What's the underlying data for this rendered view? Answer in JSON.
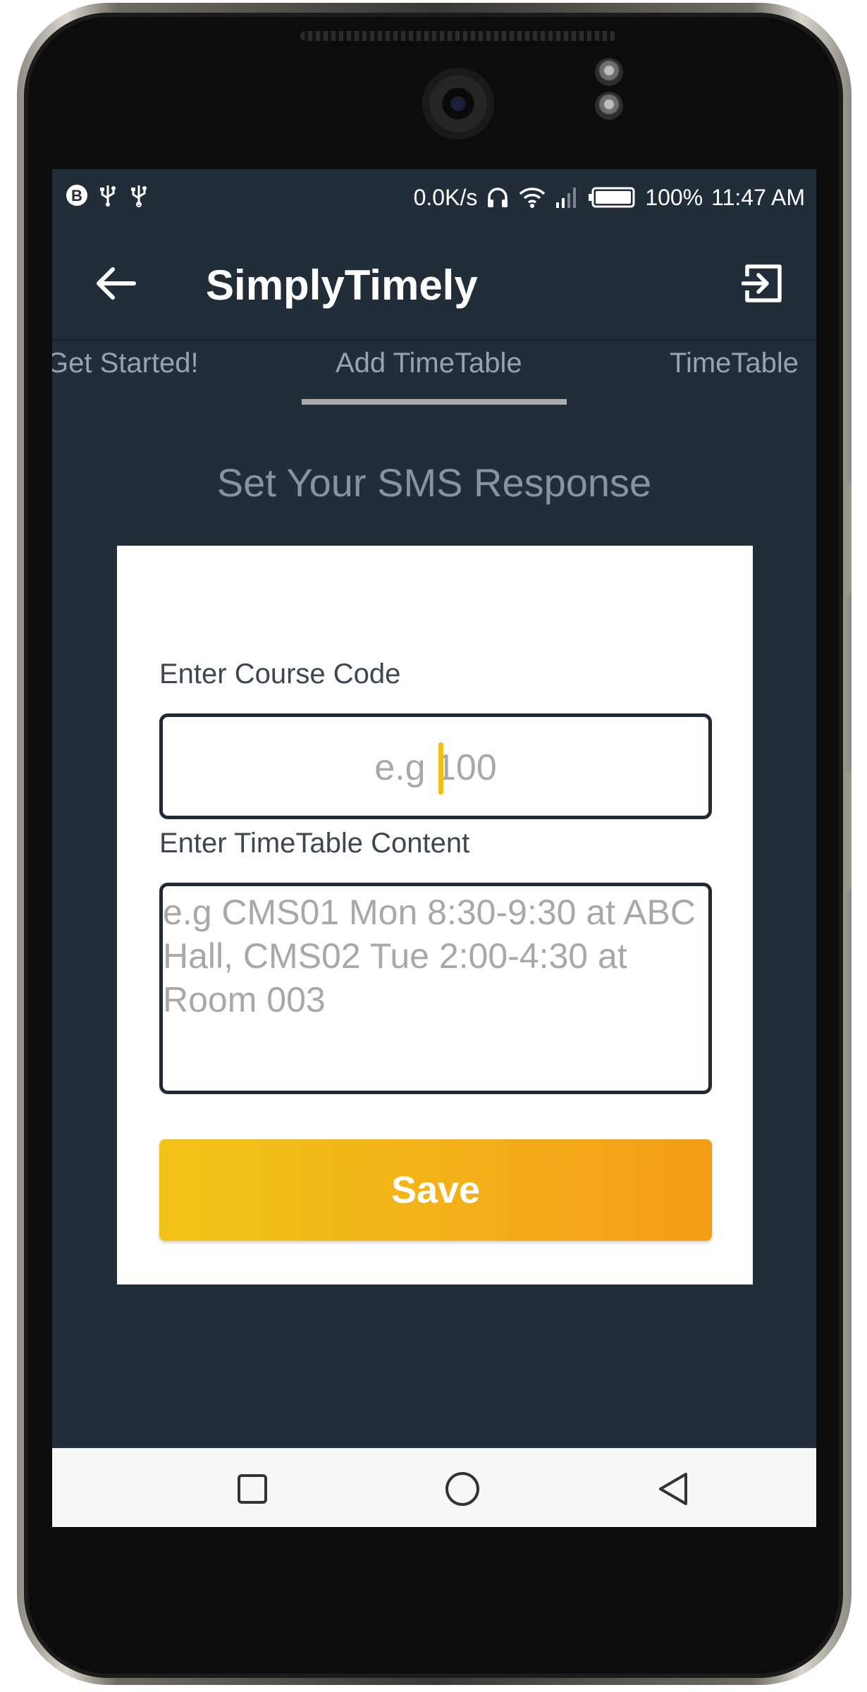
{
  "status_bar": {
    "left_icons": [
      "b-circle-icon",
      "usb-icon",
      "usb-debug-icon"
    ],
    "speed": "0.0K/s",
    "battery": "100%",
    "time": "11:47 AM"
  },
  "app_bar": {
    "title": "SimplyTimely"
  },
  "tabs": [
    {
      "label": "Get Started!"
    },
    {
      "label": "Add TimeTable",
      "selected": true
    },
    {
      "label": "TimeTable"
    }
  ],
  "page": {
    "heading": "Set Your SMS Response"
  },
  "form": {
    "course_code_label": "Enter Course Code",
    "course_code_placeholder": "e.g 100",
    "content_label": "Enter TimeTable Content",
    "content_placeholder": "e.g CMS01 Mon 8:30-9:30 at ABC Hall, CMS02 Tue 2:00-4:30 at Room 003",
    "save_label": "Save"
  },
  "colors": {
    "app_background": "#222d3a",
    "accent_start": "#f2c418",
    "accent_end": "#f39d15",
    "card": "#ffffff"
  }
}
